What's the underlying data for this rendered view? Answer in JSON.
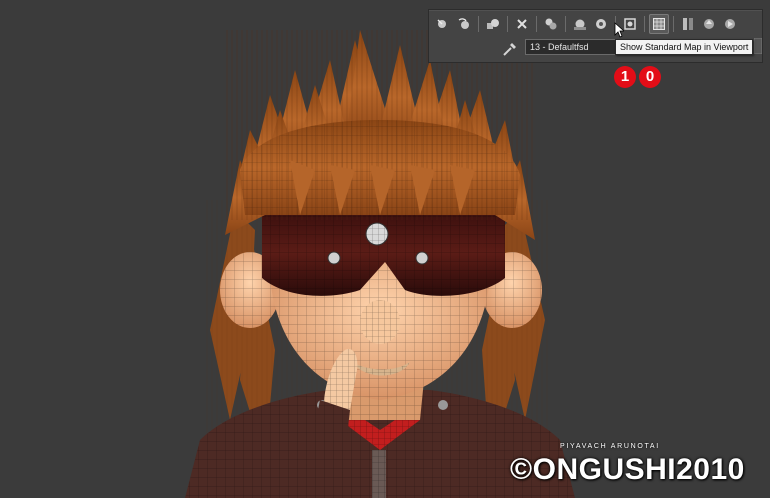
{
  "toolbar": {
    "material_name": "13 - Defaultfsd",
    "tooltip": "Show Standard Map in Viewport",
    "buttons": [
      "get-material-icon",
      "put-to-scene-icon",
      "assign-material-icon",
      "reset-map-icon",
      "make-unique-icon",
      "put-to-library-icon",
      "material-id-channel-icon",
      "show-end-result-icon",
      "show-standard-map-icon",
      "show-map-background-icon",
      "go-to-parent-icon",
      "go-forward-to-sibling-icon"
    ]
  },
  "badges": [
    "1",
    "0"
  ],
  "watermark": {
    "credit": "PIYAVACH ARUNOTAI",
    "logo": "©ONGUSHI2010"
  },
  "colors": {
    "viewport_bg": "#3b3b3b",
    "toolbar_bg": "#444444",
    "badge_red": "#e30d17",
    "hair": "#a7561e",
    "skin": "#f2b98a",
    "glasses": "#4a1512",
    "jacket": "#4d2a24"
  }
}
